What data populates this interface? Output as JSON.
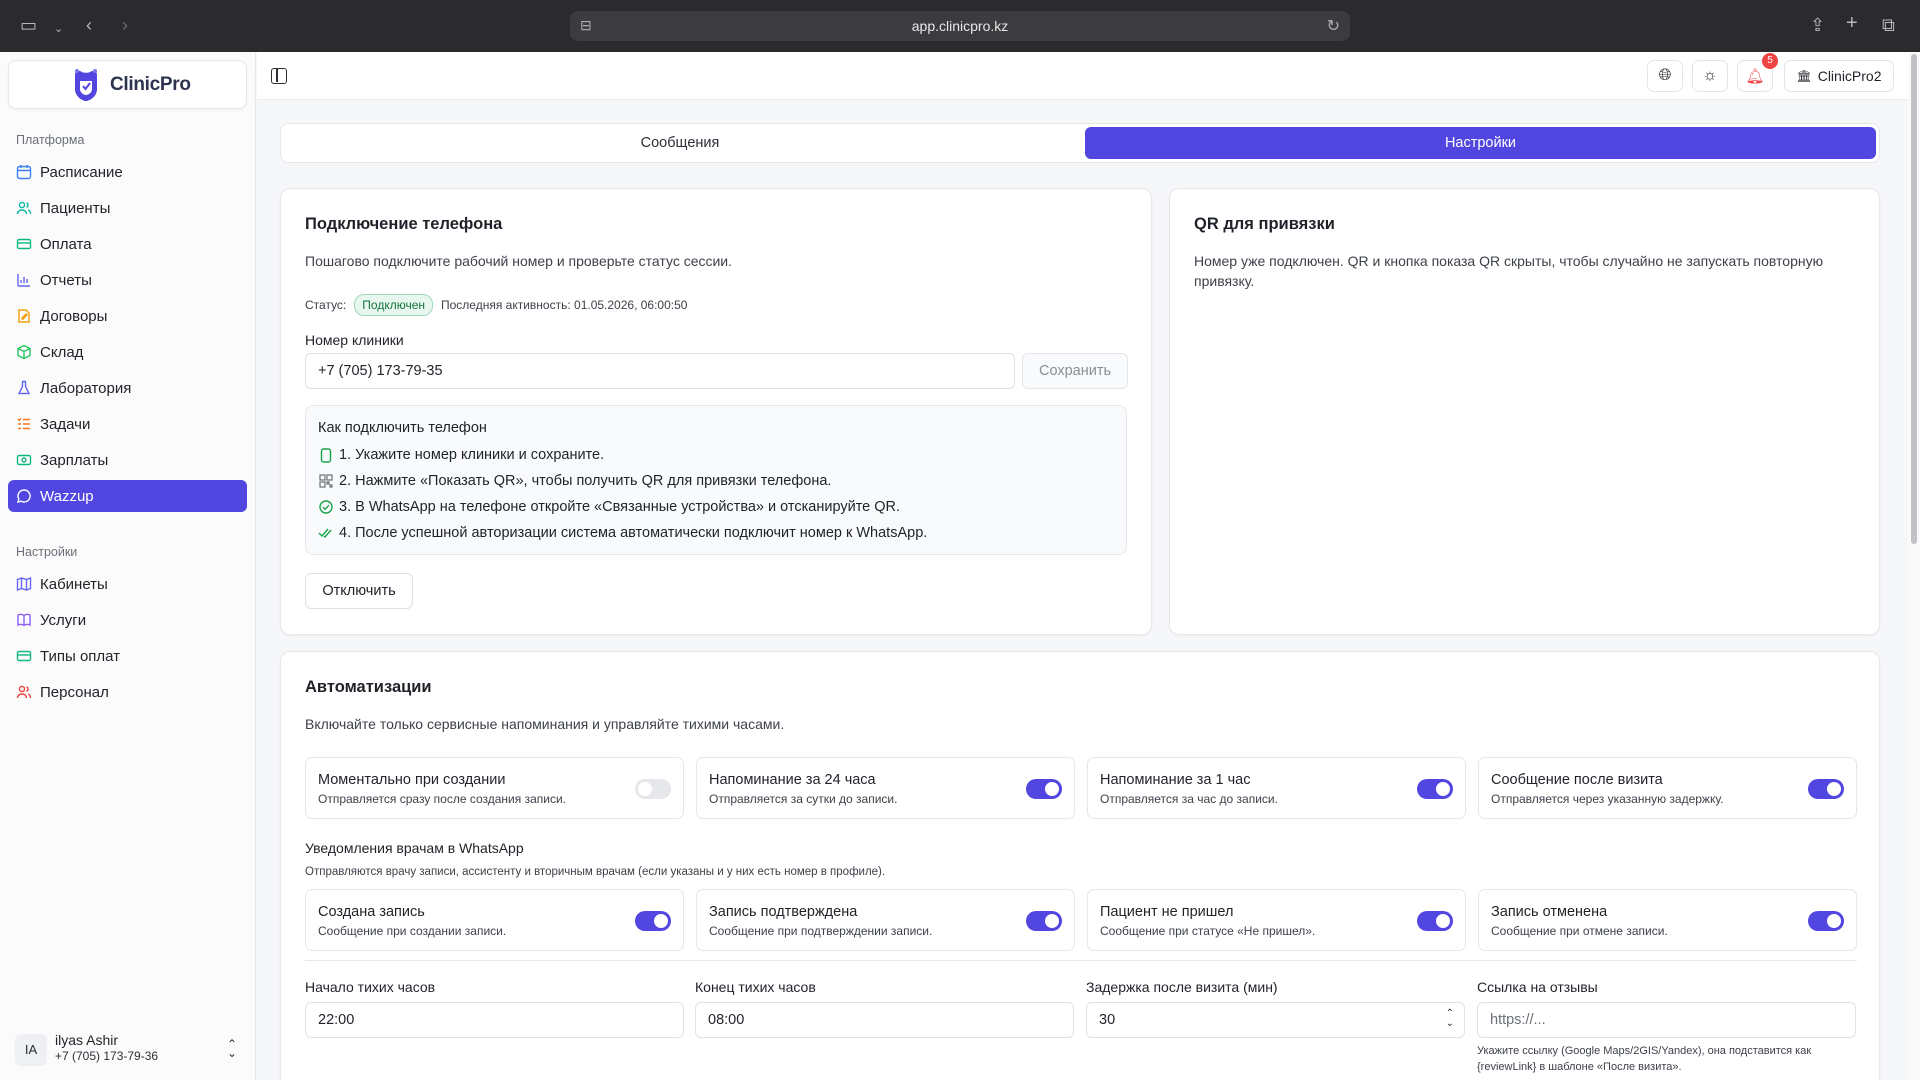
{
  "browser": {
    "url": "app.clinicpro.kz"
  },
  "brand": {
    "name": "ClinicPro",
    "accent": "#5146e0"
  },
  "sidebar": {
    "platform_label": "Платформа",
    "platform_items": [
      {
        "label": "Расписание",
        "icon": "calendar-icon",
        "color": "#3b82f6"
      },
      {
        "label": "Пациенты",
        "icon": "users-icon",
        "color": "#14b8a6"
      },
      {
        "label": "Оплата",
        "icon": "card-icon",
        "color": "#10b981"
      },
      {
        "label": "Отчеты",
        "icon": "bar-chart-icon",
        "color": "#6366f1"
      },
      {
        "label": "Договоры",
        "icon": "contract-icon",
        "color": "#f59e0b"
      },
      {
        "label": "Склад",
        "icon": "box-icon",
        "color": "#22c55e"
      },
      {
        "label": "Лаборатория",
        "icon": "flask-icon",
        "color": "#6366f1"
      },
      {
        "label": "Задачи",
        "icon": "tasks-icon",
        "color": "#f97316"
      },
      {
        "label": "Зарплаты",
        "icon": "money-icon",
        "color": "#10b981"
      },
      {
        "label": "Wazzup",
        "icon": "chat-icon",
        "color": "#ffffff",
        "active": true
      }
    ],
    "settings_label": "Настройки",
    "settings_items": [
      {
        "label": "Кабинеты",
        "icon": "map-icon",
        "color": "#6366f1"
      },
      {
        "label": "Услуги",
        "icon": "book-icon",
        "color": "#8b5cf6"
      },
      {
        "label": "Типы оплат",
        "icon": "card-icon",
        "color": "#10b981"
      },
      {
        "label": "Персонал",
        "icon": "users-icon",
        "color": "#ef4444"
      }
    ],
    "user": {
      "initials": "IA",
      "name": "ilyas Ashir",
      "phone": "+7 (705) 173-79-36"
    }
  },
  "topbar": {
    "notifications_count": "5",
    "account_label": "ClinicPro2"
  },
  "tabs": [
    {
      "label": "Сообщения",
      "active": false
    },
    {
      "label": "Настройки",
      "active": true
    }
  ],
  "phone_card": {
    "title": "Подключение телефона",
    "subtitle": "Пошагово подключите рабочий номер и проверьте статус сессии.",
    "status_label": "Статус:",
    "status_value": "Подключен",
    "last_activity": "Последняя активность: 01.05.2026, 06:00:50",
    "number_label": "Номер клиники",
    "number_value": "+7 (705) 173-79-35",
    "save_label": "Сохранить",
    "howto_title": "Как подключить телефон",
    "steps": [
      {
        "text": "1. Укажите номер клиники и сохраните.",
        "icon": "phone-icon"
      },
      {
        "text": "2. Нажмите «Показать QR», чтобы получить QR для привязки телефона.",
        "icon": "qr-icon"
      },
      {
        "text": "3. В WhatsApp на телефоне откройте «Связанные устройства» и отсканируйте QR.",
        "icon": "check-circle-icon"
      },
      {
        "text": "4. После успешной авторизации система автоматически подключит номер к WhatsApp.",
        "icon": "check-double-icon"
      }
    ],
    "disconnect_label": "Отключить"
  },
  "qr_card": {
    "title": "QR для привязки",
    "text_line1": "Номер уже подключен. QR и кнопка показа QR скрыты, чтобы случайно не запускать повторную",
    "text_line2": "привязку."
  },
  "automations": {
    "title": "Автоматизации",
    "subtitle": "Включайте только сервисные напоминания и управляйте тихими часами.",
    "patient_tiles": [
      {
        "title": "Моментально при создании",
        "desc": "Отправляется сразу после создания записи.",
        "enabled": false
      },
      {
        "title": "Напоминание за 24 часа",
        "desc": "Отправляется за сутки до записи.",
        "enabled": true
      },
      {
        "title": "Напоминание за 1 час",
        "desc": "Отправляется за час до записи.",
        "enabled": true
      },
      {
        "title": "Сообщение после визита",
        "desc": "Отправляется через указанную задержку.",
        "enabled": true
      }
    ],
    "doctor_title": "Уведомления врачам в WhatsApp",
    "doctor_subtitle": "Отправляются врачу записи, ассистенту и вторичным врачам (если указаны и у них есть номер в профиле).",
    "doctor_tiles": [
      {
        "title": "Создана запись",
        "desc": "Сообщение при создании записи.",
        "enabled": true
      },
      {
        "title": "Запись подтверждена",
        "desc": "Сообщение при подтверждении записи.",
        "enabled": true
      },
      {
        "title": "Пациент не пришел",
        "desc": "Сообщение при статусе «Не пришел».",
        "enabled": true
      },
      {
        "title": "Запись отменена",
        "desc": "Сообщение при отмене записи.",
        "enabled": true
      }
    ],
    "quiet_start_label": "Начало тихих часов",
    "quiet_start_value": "22:00",
    "quiet_end_label": "Конец тихих часов",
    "quiet_end_value": "08:00",
    "delay_label": "Задержка после визита (мин)",
    "delay_value": "30",
    "review_label": "Ссылка на отзывы",
    "review_placeholder": "https://...",
    "review_hint_1": "Укажите ссылку (Google Maps/2GIS/Yandex), она подставится как",
    "review_hint_2": "{reviewLink} в шаблоне «После визита»."
  }
}
